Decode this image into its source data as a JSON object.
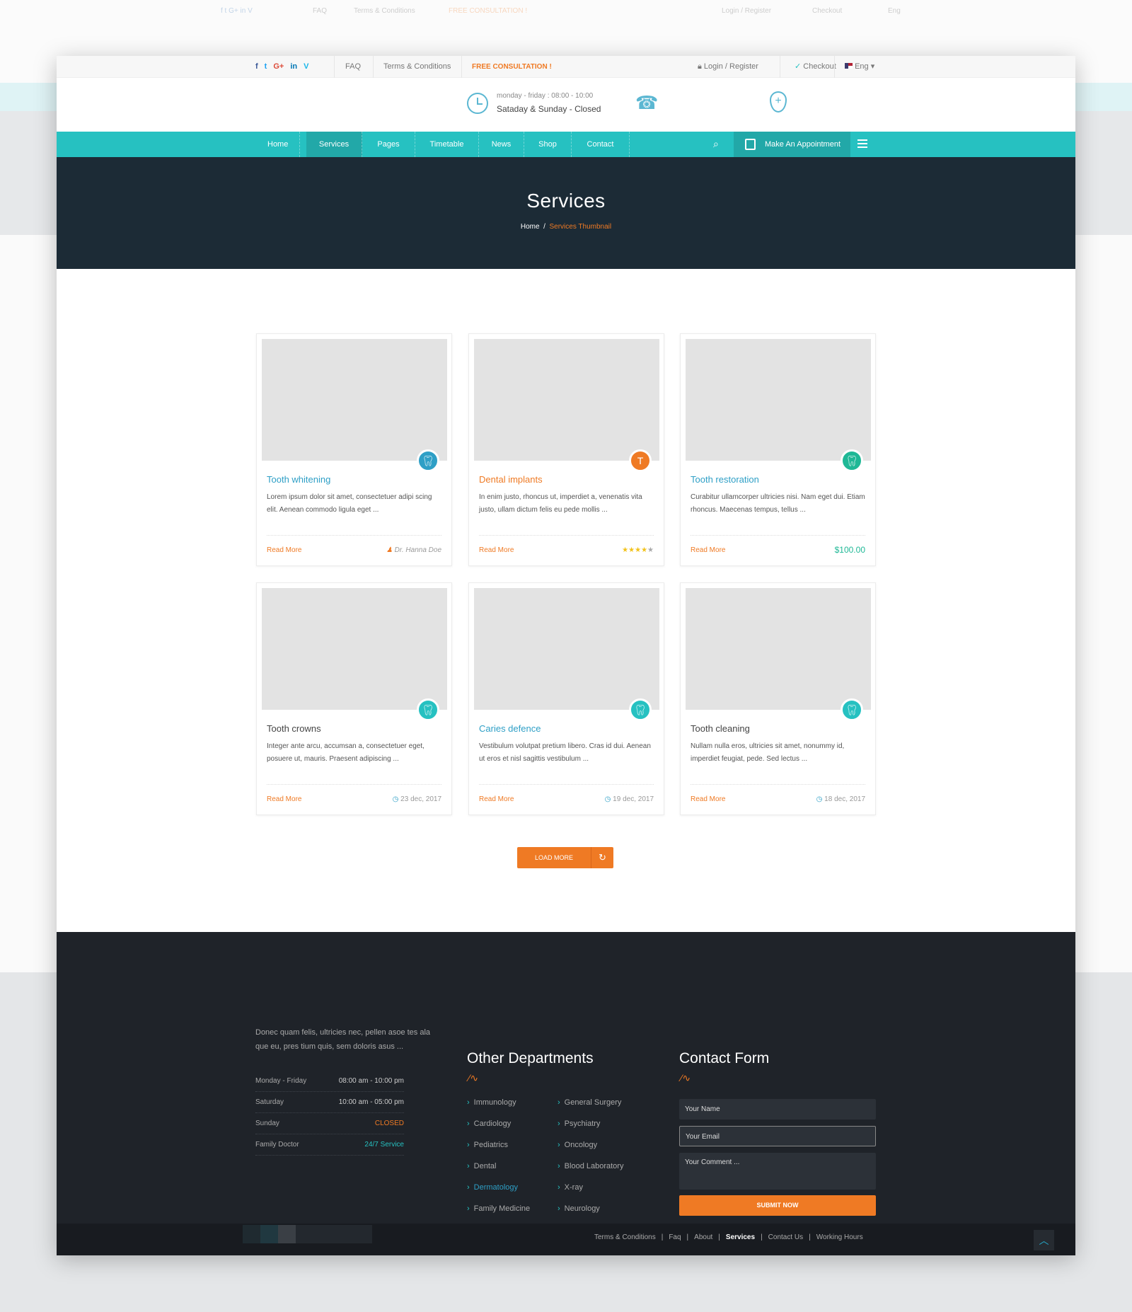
{
  "topbar": {
    "social": [
      "f",
      "t",
      "G+",
      "in",
      "V"
    ],
    "faq": "FAQ",
    "terms": "Terms & Conditions",
    "consult": "FREE CONSULTATION !",
    "login": "Login / Register",
    "checkout": "Checkout",
    "lang": "Eng"
  },
  "header": {
    "hours_weekday": "monday - friday : 08:00 - 10:00",
    "hours_weekend": "Sataday & Sunday - Closed"
  },
  "nav": {
    "items": [
      "Home",
      "Services",
      "Pages",
      "Timetable",
      "News",
      "Shop",
      "Contact"
    ],
    "active": "Services",
    "appointment": "Make An Appointment"
  },
  "hero": {
    "title": "Services",
    "crumb_home": "Home",
    "crumb_sep": "/",
    "crumb_current": "Services Thumbnail"
  },
  "cards": [
    {
      "title": "Tooth whitening",
      "text": "Lorem ipsum dolor sit amet, consectetuer adipi scing elit. Aenean commodo ligula eget ...",
      "read": "Read More",
      "meta": "Dr. Hanna Doe",
      "title_color": "#2e9fc6",
      "badge_color": "#2e9fc6"
    },
    {
      "title": "Dental implants",
      "text": "In enim justo, rhoncus ut, imperdiet a, venenatis vita justo, ullam dictum felis eu pede mollis ...",
      "read": "Read More",
      "rating": 4,
      "rating_max": 5,
      "title_color": "#ef7a24",
      "badge_color": "#ef7a24"
    },
    {
      "title": "Tooth restoration",
      "text": "Curabitur ullamcorper ultricies nisi. Nam eget dui. Etiam rhoncus. Maecenas tempus, tellus ...",
      "read": "Read More",
      "meta": "$100.00",
      "title_color": "#2e9fc6",
      "badge_color": "#1fb896"
    },
    {
      "title": "Tooth crowns",
      "text": "Integer ante arcu, accumsan a, consectetuer eget, posuere ut, mauris. Praesent adipiscing ...",
      "read": "Read More",
      "meta": "23 dec, 2017",
      "title_color": "#444444",
      "badge_color": "#26c1c1"
    },
    {
      "title": "Caries defence",
      "text": "Vestibulum volutpat pretium libero. Cras id dui. Aenean ut eros et nisl sagittis vestibulum ...",
      "read": "Read More",
      "meta": "19 dec, 2017",
      "title_color": "#2e9fc6",
      "badge_color": "#26c1c1"
    },
    {
      "title": "Tooth cleaning",
      "text": "Nullam nulla eros, ultricies sit amet, nonummy id, imperdiet feugiat, pede. Sed lectus ...",
      "read": "Read More",
      "meta": "18 dec, 2017",
      "title_color": "#444444",
      "badge_color": "#26c1c1"
    }
  ],
  "load_more": "LOAD MORE",
  "footer": {
    "about": "Donec quam felis, ultricies nec, pellen asoe tes ala que eu, pres tium quis, sem doloris asus ...",
    "hours": [
      {
        "day": "Monday - Friday",
        "time": "08:00 am - 10:00 pm"
      },
      {
        "day": "Saturday",
        "time": "10:00 am - 05:00 pm"
      },
      {
        "day": "Sunday",
        "time": "CLOSED"
      },
      {
        "day": "Family Doctor",
        "time": "24/7 Service"
      }
    ],
    "departments_title": "Other Departments",
    "departments": [
      "Immunology",
      "General Surgery",
      "Cardiology",
      "Psychiatry",
      "Pediatrics",
      "Oncology",
      "Dental",
      "Blood Laboratory",
      "Dermatology",
      "X-ray",
      "Family Medicine",
      "Neurology"
    ],
    "active_department": "Dermatology",
    "contact_title": "Contact Form",
    "name_placeholder": "Your Name",
    "email_placeholder": "Your Email",
    "comment_placeholder": "Your Comment ...",
    "submit": "SUBMIT NOW",
    "links": [
      "Terms & Conditions",
      "Faq",
      "About",
      "Services",
      "Contact Us",
      "Working Hours"
    ],
    "active_link": "Services"
  },
  "colors": {
    "teal": "#26c1c1",
    "orange": "#ef7a24",
    "navy": "#1c2b36",
    "footer": "#1f2329"
  }
}
